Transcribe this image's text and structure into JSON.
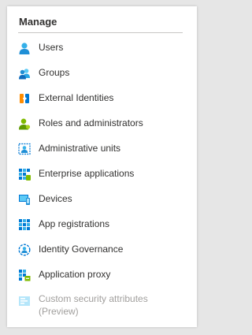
{
  "manage": {
    "header": "Manage",
    "items": [
      {
        "label": "Users",
        "icon": "user-icon"
      },
      {
        "label": "Groups",
        "icon": "groups-icon"
      },
      {
        "label": "External Identities",
        "icon": "external-identities-icon"
      },
      {
        "label": "Roles and administrators",
        "icon": "roles-icon"
      },
      {
        "label": "Administrative units",
        "icon": "administrative-units-icon"
      },
      {
        "label": "Enterprise applications",
        "icon": "enterprise-apps-icon"
      },
      {
        "label": "Devices",
        "icon": "devices-icon"
      },
      {
        "label": "App registrations",
        "icon": "app-registrations-icon"
      },
      {
        "label": "Identity Governance",
        "icon": "identity-governance-icon"
      },
      {
        "label": "Application proxy",
        "icon": "application-proxy-icon"
      },
      {
        "label": "Custom security attributes (Preview)",
        "icon": "custom-security-attributes-icon",
        "disabled": true
      }
    ]
  },
  "colors": {
    "accent": "#0078d4",
    "green": "#5ea0ef",
    "text": "#323130",
    "disabled_text": "#a19f9d"
  }
}
